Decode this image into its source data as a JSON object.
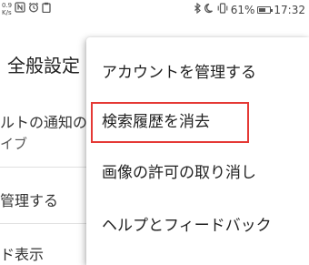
{
  "status_bar": {
    "net_speed_value": "0.9",
    "net_speed_unit": "K/s",
    "battery_percent": "61%",
    "battery_level": 0.61,
    "time": "17:32",
    "left_icons": [
      "nfc-icon",
      "alarm-icon",
      "clipboard-icon"
    ],
    "right_icons": [
      "bluetooth-icon",
      "do-not-disturb-icon",
      "vibrate-icon"
    ]
  },
  "settings": {
    "title": "全般設定",
    "row1_line1": "ルトの通知の",
    "row1_line2": "イブ",
    "row2": "管理する",
    "row3": "ド表示"
  },
  "menu": {
    "items": [
      {
        "label": "アカウントを管理する"
      },
      {
        "label": "検索履歴を消去"
      },
      {
        "label": "画像の許可の取り消し"
      },
      {
        "label": "ヘルプとフィードバック"
      }
    ]
  },
  "colors": {
    "highlight": "#e53935",
    "menu_background": "#ffffff",
    "text": "#212121"
  }
}
